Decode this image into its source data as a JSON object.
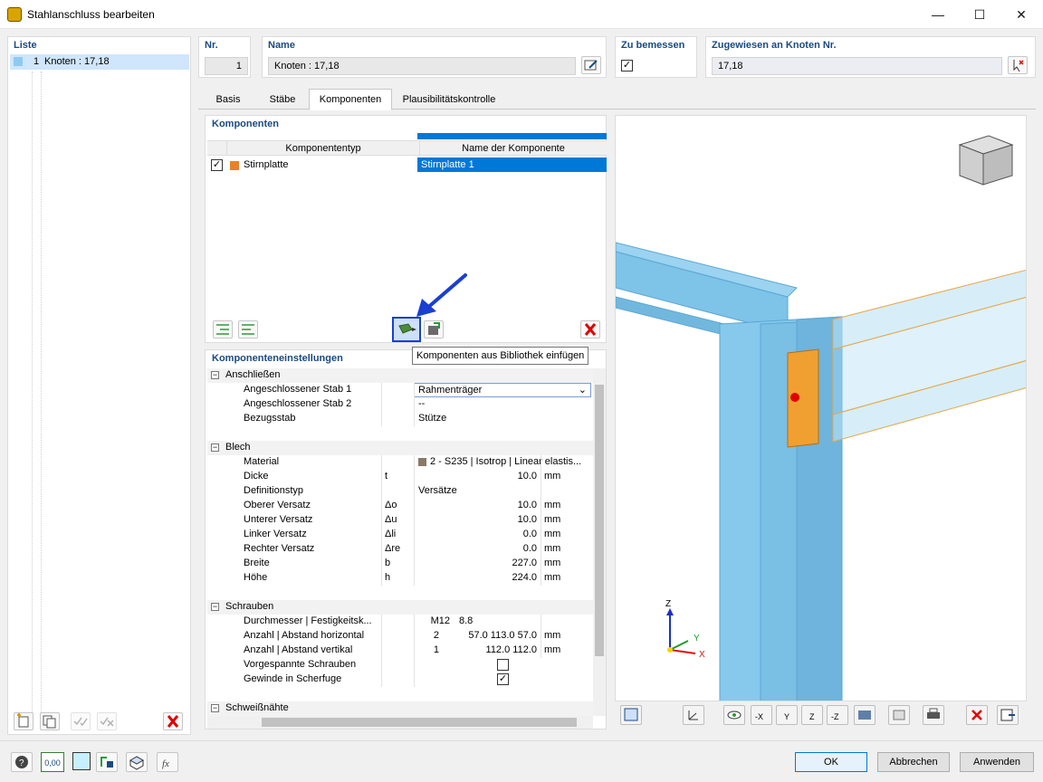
{
  "window": {
    "title": "Stahlanschluss bearbeiten",
    "minimize": "—",
    "maximize": "☐",
    "close": "✕"
  },
  "list": {
    "header": "Liste",
    "items": [
      {
        "num": "1",
        "label": "Knoten : 17,18"
      }
    ]
  },
  "nr": {
    "label": "Nr.",
    "value": "1"
  },
  "name": {
    "label": "Name",
    "value": "Knoten : 17,18"
  },
  "design": {
    "label": "Zu bemessen",
    "checked": "✓"
  },
  "assigned": {
    "label": "Zugewiesen an Knoten Nr.",
    "value": "17,18"
  },
  "tabs": [
    "Basis",
    "Stäbe",
    "Komponenten",
    "Plausibilitätskontrolle"
  ],
  "components": {
    "header": "Komponenten",
    "col_type": "Komponententyp",
    "col_name": "Name der Komponente",
    "rows": [
      {
        "type": "Stirnplatte",
        "name": "Stirnplatte 1",
        "checked": "✓",
        "color": "#e8822a"
      }
    ]
  },
  "tooltip": "Komponenten aus Bibliothek einfügen",
  "settings": {
    "header": "Komponenteneinstellungen",
    "sections": {
      "anschliessen": "Anschließen",
      "blech": "Blech",
      "schrauben": "Schrauben",
      "schweiss": "Schweißnähte"
    },
    "rows": {
      "stab1": {
        "label": "Angeschlossener Stab 1",
        "value": "Rahmenträger"
      },
      "stab2": {
        "label": "Angeschlossener Stab 2",
        "value": "--"
      },
      "bezug": {
        "label": "Bezugsstab",
        "value": "Stütze"
      },
      "material": {
        "label": "Material",
        "value": "2 - S235 | Isotrop | Linear elastis..."
      },
      "dicke": {
        "label": "Dicke",
        "sym": "t",
        "value": "10.0",
        "unit": "mm"
      },
      "deftyp": {
        "label": "Definitionstyp",
        "value": "Versätze"
      },
      "oben": {
        "label": "Oberer Versatz",
        "sym": "Δo",
        "value": "10.0",
        "unit": "mm"
      },
      "unten": {
        "label": "Unterer Versatz",
        "sym": "Δu",
        "value": "10.0",
        "unit": "mm"
      },
      "links": {
        "label": "Linker Versatz",
        "sym": "Δli",
        "value": "0.0",
        "unit": "mm"
      },
      "rechts": {
        "label": "Rechter Versatz",
        "sym": "Δre",
        "value": "0.0",
        "unit": "mm"
      },
      "breite": {
        "label": "Breite",
        "sym": "b",
        "value": "227.0",
        "unit": "mm"
      },
      "hoehe": {
        "label": "Höhe",
        "sym": "h",
        "value": "224.0",
        "unit": "mm"
      },
      "durchm": {
        "label": "Durchmesser | Festigkeitsk...",
        "a": "M12",
        "b": "8.8"
      },
      "anzh": {
        "label": "Anzahl | Abstand horizontal",
        "a": "2",
        "b": "57.0 113.0 57.0",
        "unit": "mm"
      },
      "anzv": {
        "label": "Anzahl | Abstand vertikal",
        "a": "1",
        "b": "112.0 112.0",
        "unit": "mm"
      },
      "vorg": {
        "label": "Vorgespannte Schrauben"
      },
      "gewinde": {
        "label": "Gewinde in Scherfuge",
        "checked": "✓"
      }
    }
  },
  "axes": {
    "z": "Z",
    "y": "Y",
    "x": "X"
  },
  "buttons": {
    "ok": "OK",
    "cancel": "Abbrechen",
    "apply": "Anwenden"
  },
  "status_zero": "0,00"
}
